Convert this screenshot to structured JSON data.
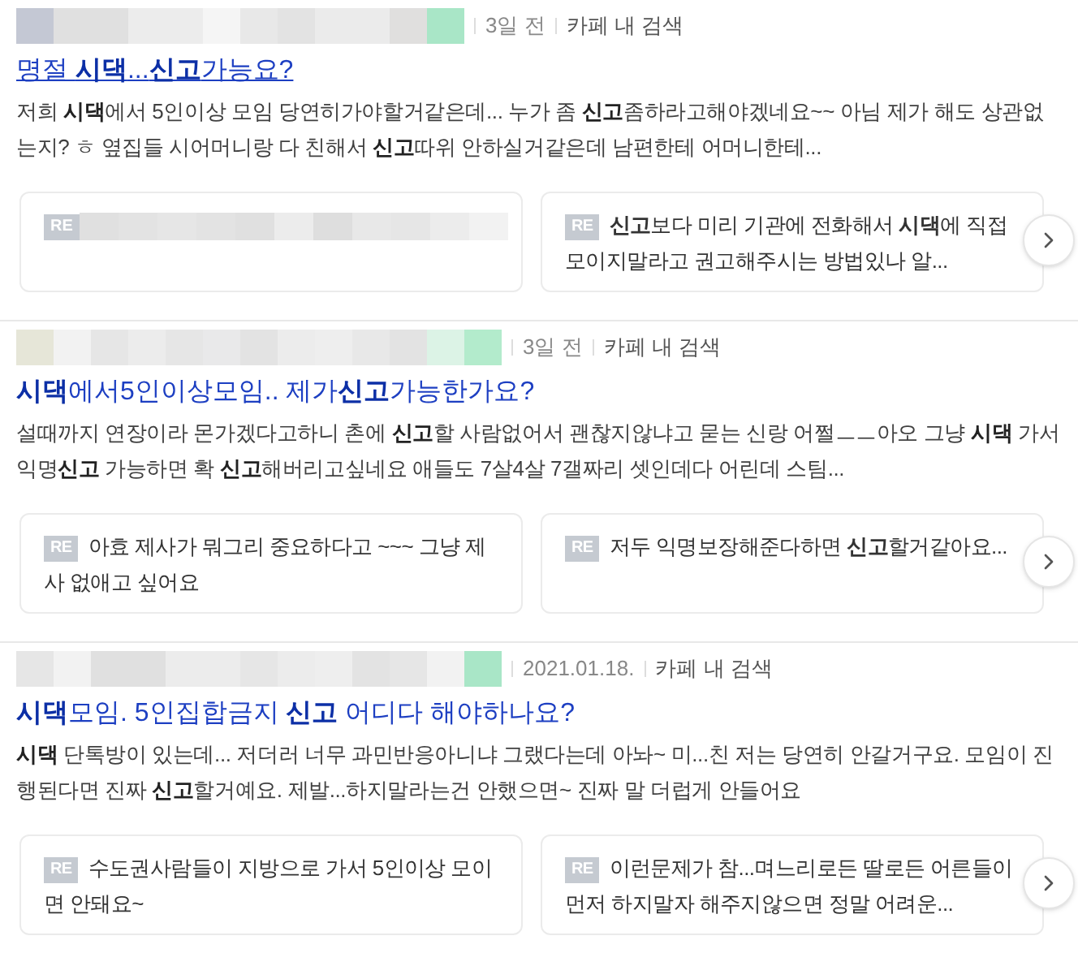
{
  "results": [
    {
      "date": "3일 전",
      "source_label": "카페 내 검색",
      "title": "명절 **시댁**...**신고**가능요?",
      "underlined": true,
      "snippet": "저희 **시댁**에서 5인이상 모임 당연히가야할거같은데... 누가 좀 **신고**좀하라고해야겠네요~~ 아님 제가 해도 상관없는지? ㅎ 옆집들 시어머니랑 다 친해서 **신고**따위 안하실거같은데 남편한테 어머니한테...",
      "replies": [
        {
          "kind": "redacted",
          "badge": "RE"
        },
        {
          "kind": "text",
          "badge": "RE",
          "text": "**신고**보다 미리 기관에 전화해서 **시댁**에 직접 모이지말라고 권고해주시는 방법있나 알..."
        }
      ]
    },
    {
      "date": "3일 전",
      "source_label": "카페 내 검색",
      "title": "**시댁**에서5인이상모임.. 제가**신고**가능한가요?",
      "underlined": false,
      "snippet": "설때까지 연장이라 몬가겠다고하니 촌에 **신고**할 사람없어서 괜찮지않냐고 묻는 신랑 어쩔ㅡㅡ아오 그냥 **시댁** 가서 익명**신고** 가능하면 확 **신고**해버리고싶네요 애들도 7살4살 7갤짜리 셋인데다 어린데 스팀...",
      "replies": [
        {
          "kind": "text",
          "badge": "RE",
          "text": "아효 제사가 뭐그리 중요하다고 ~~~ 그냥 제사 없애고 싶어요"
        },
        {
          "kind": "text",
          "badge": "RE",
          "text": "저두 익명보장해준다하면 **신고**할거같아요..."
        }
      ]
    },
    {
      "date": "2021.01.18.",
      "source_label": "카페 내 검색",
      "title": "**시댁**모임. 5인집합금지 **신고** 어디다 해야하나요?",
      "underlined": false,
      "snippet": "**시댁** 단톡방이 있는데... 저더러 너무 과민반응아니냐 그랬다는데 아놔~ 미...친 저는 당연히 안갈거구요. 모임이 진행된다면 진짜 **신고**할거예요. 제발...하지말라는건 안했으면~ 진짜 말 더럽게 안들어요",
      "replies": [
        {
          "kind": "text",
          "badge": "RE",
          "text": "수도권사람들이 지방으로 가서 5인이상 모이면 안돼요~"
        },
        {
          "kind": "text",
          "badge": "RE",
          "text": "이런문제가 참...며느리로든 딸로든 어른들이 먼저 하지말자 해주지않으면 정말 어려운..."
        }
      ]
    }
  ]
}
